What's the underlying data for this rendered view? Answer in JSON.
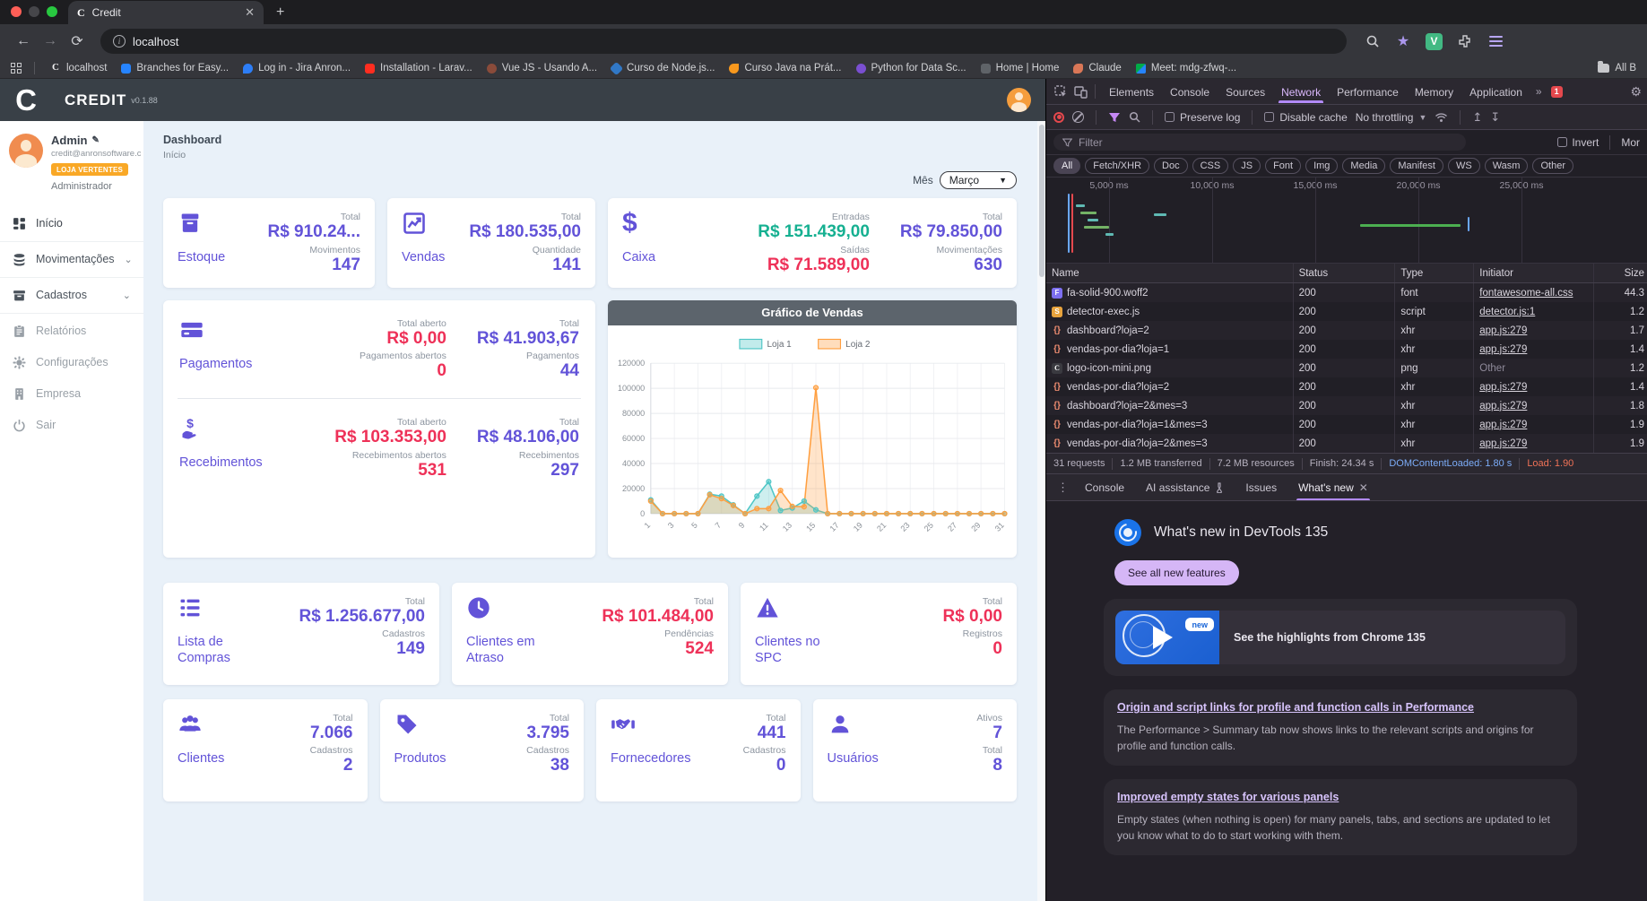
{
  "browser": {
    "tab_title": "Credit",
    "url": "localhost",
    "bookmarks": [
      "localhost",
      "Branches for Easy...",
      "Log in - Jira Anron...",
      "Installation - Larav...",
      "Vue JS - Usando A...",
      "Curso de Node.js...",
      "Curso Java na Prát...",
      "Python for Data Sc...",
      "Home | Home",
      "Claude",
      "Meet: mdg-zfwq-..."
    ],
    "all_bookmarks": "All B"
  },
  "app": {
    "brand": "CREDIT",
    "version": "v0.1.88",
    "logo_letter": "C",
    "user": {
      "name": "Admin",
      "email": "credit@anronsoftware.co...",
      "badge": "LOJA VERTENTES",
      "role": "Administrador"
    },
    "menu": [
      {
        "label": "Início"
      },
      {
        "label": "Movimentações"
      },
      {
        "label": "Cadastros"
      },
      {
        "label": "Relatórios"
      },
      {
        "label": "Configurações"
      },
      {
        "label": "Empresa"
      },
      {
        "label": "Sair"
      }
    ],
    "page": {
      "title": "Dashboard",
      "subtitle": "Início"
    },
    "month": {
      "label": "Mês",
      "value": "Março"
    },
    "cards": {
      "estoque": {
        "title": "Estoque",
        "stats": [
          {
            "label": "Total",
            "value": "R$ 910.24..."
          },
          {
            "label": "Movimentos",
            "value": "147"
          }
        ]
      },
      "vendas": {
        "title": "Vendas",
        "stats": [
          {
            "label": "Total",
            "value": "R$ 180.535,00"
          },
          {
            "label": "Quantidade",
            "value": "141"
          }
        ]
      },
      "caixa": {
        "title": "Caixa",
        "flow": [
          {
            "label": "Entradas",
            "value": "R$ 151.439,00"
          },
          {
            "label": "Saídas",
            "value": "R$ 71.589,00"
          }
        ],
        "totals": [
          {
            "label": "Total",
            "value": "R$ 79.850,00"
          },
          {
            "label": "Movimentações",
            "value": "630"
          }
        ]
      },
      "pagamentos": {
        "title": "Pagamentos",
        "open": [
          {
            "label": "Total aberto",
            "value": "R$ 0,00"
          },
          {
            "label": "Pagamentos abertos",
            "value": "0"
          }
        ],
        "totals": [
          {
            "label": "Total",
            "value": "R$ 41.903,67"
          },
          {
            "label": "Pagamentos",
            "value": "44"
          }
        ]
      },
      "recebimentos": {
        "title": "Recebimentos",
        "open": [
          {
            "label": "Total aberto",
            "value": "R$ 103.353,00"
          },
          {
            "label": "Recebimentos abertos",
            "value": "531"
          }
        ],
        "totals": [
          {
            "label": "Total",
            "value": "R$ 48.106,00"
          },
          {
            "label": "Recebimentos",
            "value": "297"
          }
        ]
      },
      "lista_compras": {
        "title": "Lista de Compras",
        "stats": [
          {
            "label": "Total",
            "value": "R$ 1.256.677,00"
          },
          {
            "label": "Cadastros",
            "value": "149"
          }
        ]
      },
      "clientes_atraso": {
        "title": "Clientes em Atraso",
        "stats": [
          {
            "label": "Total",
            "value": "R$ 101.484,00"
          },
          {
            "label": "Pendências",
            "value": "524"
          }
        ]
      },
      "clientes_spc": {
        "title": "Clientes no SPC",
        "stats": [
          {
            "label": "Total",
            "value": "R$ 0,00"
          },
          {
            "label": "Registros",
            "value": "0"
          }
        ]
      },
      "clientes": {
        "title": "Clientes",
        "stats": [
          {
            "label": "Total",
            "value": "7.066"
          },
          {
            "label": "Cadastros",
            "value": "2"
          }
        ]
      },
      "produtos": {
        "title": "Produtos",
        "stats": [
          {
            "label": "Total",
            "value": "3.795"
          },
          {
            "label": "Cadastros",
            "value": "38"
          }
        ]
      },
      "fornecedores": {
        "title": "Fornecedores",
        "stats": [
          {
            "label": "Total",
            "value": "441"
          },
          {
            "label": "Cadastros",
            "value": "0"
          }
        ]
      },
      "usuarios": {
        "title": "Usuários",
        "stats": [
          {
            "label": "Ativos",
            "value": "7"
          },
          {
            "label": "Total",
            "value": "8"
          }
        ]
      }
    }
  },
  "chart_data": {
    "type": "line",
    "title": "Gráfico de Vendas",
    "x": [
      1,
      2,
      3,
      4,
      5,
      6,
      7,
      8,
      9,
      10,
      11,
      12,
      13,
      14,
      15,
      16,
      17,
      18,
      19,
      20,
      21,
      22,
      23,
      24,
      25,
      26,
      27,
      28,
      29,
      30,
      31
    ],
    "x_ticks_shown": [
      1,
      3,
      5,
      7,
      9,
      11,
      13,
      15,
      17,
      19,
      21,
      23,
      25,
      27,
      29,
      31
    ],
    "ylim": [
      0,
      120000
    ],
    "yticks": [
      0,
      20000,
      40000,
      60000,
      80000,
      100000,
      120000
    ],
    "grid": true,
    "legend_position": "top",
    "series": [
      {
        "name": "Loja 1",
        "color": "#4ec6c6",
        "values": [
          11000,
          0,
          0,
          0,
          0,
          15500,
          14000,
          7000,
          0,
          14000,
          25500,
          2500,
          4500,
          10000,
          3000,
          0,
          0,
          0,
          0,
          0,
          0,
          0,
          0,
          0,
          0,
          0,
          0,
          0,
          0,
          0,
          0
        ]
      },
      {
        "name": "Loja 2",
        "color": "#ff9f40",
        "values": [
          10000,
          0,
          0,
          0,
          0,
          15000,
          12000,
          6500,
          0,
          4000,
          4000,
          18500,
          5800,
          5500,
          100500,
          0,
          0,
          0,
          0,
          0,
          0,
          0,
          0,
          0,
          0,
          0,
          0,
          0,
          0,
          0,
          0
        ]
      }
    ]
  },
  "devtools": {
    "tabs": [
      {
        "label": "Elements"
      },
      {
        "label": "Console"
      },
      {
        "label": "Sources"
      },
      {
        "label": "Network",
        "state": "active"
      },
      {
        "label": "Performance"
      },
      {
        "label": "Memory"
      },
      {
        "label": "Application"
      }
    ],
    "error_badge": "1",
    "netbar": {
      "preserve_log": "Preserve log",
      "disable_cache": "Disable cache",
      "throttling": "No throttling"
    },
    "filter": {
      "placeholder": "Filter",
      "invert": "Invert",
      "more": "Mor"
    },
    "type_pills": [
      {
        "label": "All",
        "state": "active"
      },
      {
        "label": "Fetch/XHR"
      },
      {
        "label": "Doc"
      },
      {
        "label": "CSS"
      },
      {
        "label": "JS"
      },
      {
        "label": "Font"
      },
      {
        "label": "Img"
      },
      {
        "label": "Media"
      },
      {
        "label": "Manifest"
      },
      {
        "label": "WS"
      },
      {
        "label": "Wasm"
      },
      {
        "label": "Other"
      }
    ],
    "timeline_ticks": [
      "5,000 ms",
      "10,000 ms",
      "15,000 ms",
      "20,000 ms",
      "25,000 ms"
    ],
    "table": {
      "columns": [
        "Name",
        "Status",
        "Type",
        "Initiator",
        "Size"
      ],
      "rows": [
        {
          "name": "fa-solid-900.woff2",
          "status": "200",
          "type": "font",
          "initiator": "fontawesome-all.css",
          "size": "44.3",
          "icon": "font",
          "ilk": "link"
        },
        {
          "name": "detector-exec.js",
          "status": "200",
          "type": "script",
          "initiator": "detector.js:1",
          "size": "1.2",
          "icon": "script",
          "ilk": "link"
        },
        {
          "name": "dashboard?loja=2",
          "status": "200",
          "type": "xhr",
          "initiator": "app.js:279",
          "size": "1.7",
          "icon": "xhr",
          "ilk": "link"
        },
        {
          "name": "vendas-por-dia?loja=1",
          "status": "200",
          "type": "xhr",
          "initiator": "app.js:279",
          "size": "1.4",
          "icon": "xhr",
          "ilk": "link"
        },
        {
          "name": "logo-icon-mini.png",
          "status": "200",
          "type": "png",
          "initiator": "Other",
          "size": "1.2",
          "icon": "img",
          "ilk": "plain"
        },
        {
          "name": "vendas-por-dia?loja=2",
          "status": "200",
          "type": "xhr",
          "initiator": "app.js:279",
          "size": "1.4",
          "icon": "xhr",
          "ilk": "link"
        },
        {
          "name": "dashboard?loja=2&mes=3",
          "status": "200",
          "type": "xhr",
          "initiator": "app.js:279",
          "size": "1.8",
          "icon": "xhr",
          "ilk": "link"
        },
        {
          "name": "vendas-por-dia?loja=1&mes=3",
          "status": "200",
          "type": "xhr",
          "initiator": "app.js:279",
          "size": "1.9",
          "icon": "xhr",
          "ilk": "link"
        },
        {
          "name": "vendas-por-dia?loja=2&mes=3",
          "status": "200",
          "type": "xhr",
          "initiator": "app.js:279",
          "size": "1.9",
          "icon": "xhr",
          "ilk": "link"
        }
      ]
    },
    "summary": {
      "requests": "31 requests",
      "transferred": "1.2 MB transferred",
      "resources": "7.2 MB resources",
      "finish": "Finish: 24.34 s",
      "dcl": "DOMContentLoaded: 1.80 s",
      "load": "Load: 1.90"
    },
    "drawer": {
      "tabs": {
        "console": "Console",
        "ai": "AI assistance",
        "issues": "Issues",
        "whatsnew": "What's new"
      },
      "whats_new": {
        "title": "What's new in DevTools 135",
        "button": "See all new features",
        "badge": "new",
        "highlight": "See the highlights from Chrome 135",
        "items": [
          {
            "heading": "Origin and script links for profile and function calls in Performance",
            "body": "The Performance > Summary tab now shows links to the relevant scripts and origins for profile and function calls."
          },
          {
            "heading": "Improved empty states for various panels",
            "body": "Empty states (when nothing is open) for many panels, tabs, and sections are updated to let you know what to do to start working with them."
          }
        ]
      }
    },
    "accent_color": "#b18af8",
    "error_color": "#e5484d"
  },
  "theme": {
    "purple": "#6253d8",
    "red": "#ee3158",
    "green": "#16b091",
    "header_bg": "#394047",
    "main_bg": "#e9f1f9"
  }
}
